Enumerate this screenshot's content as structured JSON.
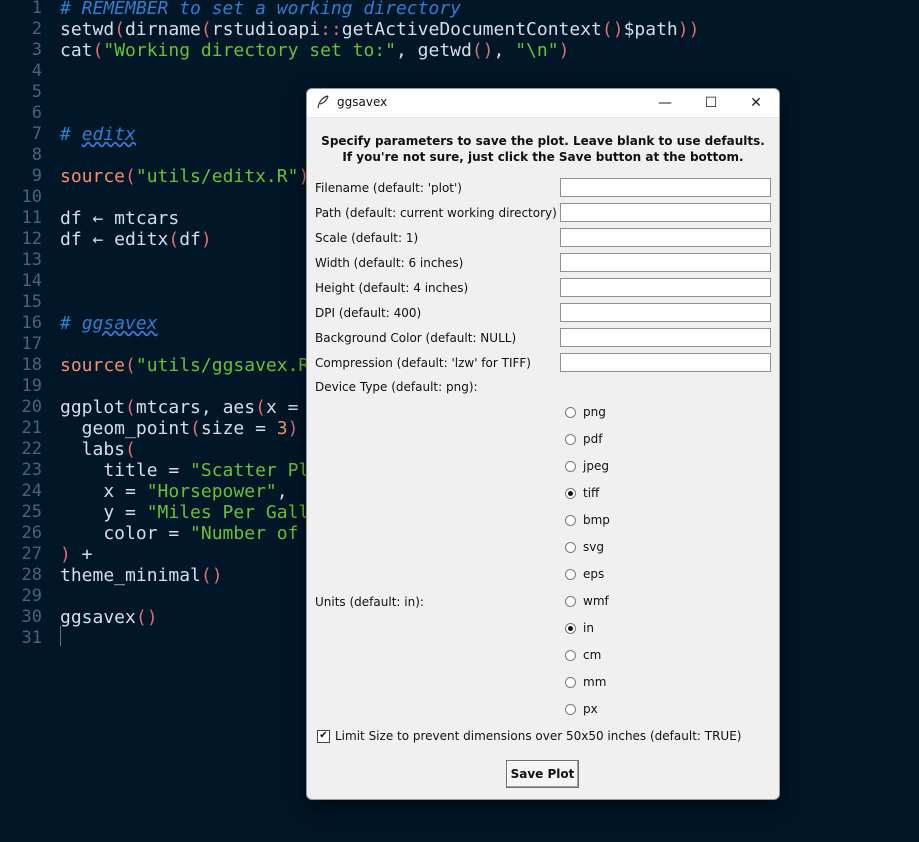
{
  "editor": {
    "lines": [
      {
        "n": "1",
        "segs": [
          {
            "t": "# REMEMBER to set a working directory",
            "c": "cm"
          }
        ]
      },
      {
        "n": "2",
        "segs": [
          {
            "t": "setwd",
            "c": "fn"
          },
          {
            "t": "(",
            "c": "pu"
          },
          {
            "t": "dirname",
            "c": "fn"
          },
          {
            "t": "(",
            "c": "pu"
          },
          {
            "t": "rstudioapi",
            "c": "fn"
          },
          {
            "t": "::",
            "c": "pu"
          },
          {
            "t": "getActiveDocumentContext",
            "c": "fn"
          },
          {
            "t": "()",
            "c": "pu"
          },
          {
            "t": "$path",
            "c": "fn"
          },
          {
            "t": "))",
            "c": "pu"
          }
        ]
      },
      {
        "n": "3",
        "segs": [
          {
            "t": "cat",
            "c": "fn"
          },
          {
            "t": "(",
            "c": "pu"
          },
          {
            "t": "\"Working directory set to:\"",
            "c": "str"
          },
          {
            "t": ", ",
            "c": "fn"
          },
          {
            "t": "getwd",
            "c": "fn"
          },
          {
            "t": "()",
            "c": "pu"
          },
          {
            "t": ", ",
            "c": "fn"
          },
          {
            "t": "\"\\n\"",
            "c": "str"
          },
          {
            "t": ")",
            "c": "pu"
          }
        ]
      },
      {
        "n": "4",
        "segs": []
      },
      {
        "n": "5",
        "segs": []
      },
      {
        "n": "6",
        "segs": []
      },
      {
        "n": "7",
        "segs": [
          {
            "t": "# ",
            "c": "cm"
          },
          {
            "t": "editx",
            "c": "cm-u"
          }
        ]
      },
      {
        "n": "8",
        "segs": []
      },
      {
        "n": "9",
        "segs": [
          {
            "t": "source",
            "c": "src"
          },
          {
            "t": "(",
            "c": "pu"
          },
          {
            "t": "\"utils/editx.R\"",
            "c": "str"
          },
          {
            "t": ")",
            "c": "pu"
          }
        ]
      },
      {
        "n": "10",
        "segs": []
      },
      {
        "n": "11",
        "segs": [
          {
            "t": "df ← mtcars",
            "c": "fn"
          }
        ]
      },
      {
        "n": "12",
        "segs": [
          {
            "t": "df ← editx",
            "c": "fn"
          },
          {
            "t": "(",
            "c": "pu"
          },
          {
            "t": "df",
            "c": "fn"
          },
          {
            "t": ")",
            "c": "pu"
          }
        ]
      },
      {
        "n": "13",
        "segs": []
      },
      {
        "n": "14",
        "segs": []
      },
      {
        "n": "15",
        "segs": []
      },
      {
        "n": "16",
        "segs": [
          {
            "t": "# ",
            "c": "cm"
          },
          {
            "t": "ggsavex",
            "c": "cm-u"
          }
        ]
      },
      {
        "n": "17",
        "segs": []
      },
      {
        "n": "18",
        "segs": [
          {
            "t": "source",
            "c": "src"
          },
          {
            "t": "(",
            "c": "pu"
          },
          {
            "t": "\"utils/ggsavex.R",
            "c": "str"
          }
        ]
      },
      {
        "n": "19",
        "segs": []
      },
      {
        "n": "20",
        "segs": [
          {
            "t": "ggplot",
            "c": "fn"
          },
          {
            "t": "(",
            "c": "pu"
          },
          {
            "t": "mtcars, ",
            "c": "fn"
          },
          {
            "t": "aes",
            "c": "fn"
          },
          {
            "t": "(",
            "c": "pu"
          },
          {
            "t": "x = ",
            "c": "fn"
          }
        ]
      },
      {
        "n": "21",
        "segs": [
          {
            "t": "  geom_point",
            "c": "fn"
          },
          {
            "t": "(",
            "c": "pu"
          },
          {
            "t": "size = ",
            "c": "fn"
          },
          {
            "t": "3",
            "c": "num"
          },
          {
            "t": ")",
            "c": "pu"
          }
        ]
      },
      {
        "n": "22",
        "segs": [
          {
            "t": "  labs",
            "c": "fn"
          },
          {
            "t": "(",
            "c": "pu"
          }
        ]
      },
      {
        "n": "23",
        "segs": [
          {
            "t": "    title = ",
            "c": "fn"
          },
          {
            "t": "\"Scatter Pl",
            "c": "str"
          }
        ]
      },
      {
        "n": "24",
        "segs": [
          {
            "t": "    x = ",
            "c": "fn"
          },
          {
            "t": "\"Horsepower\"",
            "c": "str"
          },
          {
            "t": ",",
            "c": "fn"
          }
        ]
      },
      {
        "n": "25",
        "segs": [
          {
            "t": "    y = ",
            "c": "fn"
          },
          {
            "t": "\"Miles Per Gall",
            "c": "str"
          }
        ]
      },
      {
        "n": "26",
        "segs": [
          {
            "t": "    color = ",
            "c": "fn"
          },
          {
            "t": "\"Number of",
            "c": "str"
          }
        ]
      },
      {
        "n": "27",
        "segs": [
          {
            "t": ")",
            "c": "pu"
          },
          {
            "t": " +",
            "c": "fn"
          }
        ]
      },
      {
        "n": "28",
        "segs": [
          {
            "t": "theme_minimal",
            "c": "fn"
          },
          {
            "t": "()",
            "c": "pu"
          }
        ]
      },
      {
        "n": "29",
        "segs": []
      },
      {
        "n": "30",
        "segs": [
          {
            "t": "ggsavex",
            "c": "fn"
          },
          {
            "t": "()",
            "c": "pu"
          }
        ]
      },
      {
        "n": "31",
        "segs": []
      }
    ]
  },
  "dialog": {
    "title": "ggsavex",
    "min_glyph": "—",
    "max_glyph": "☐",
    "close_glyph": "✕",
    "intro_line1": "Specify parameters to save the plot. Leave blank to use defaults.",
    "intro_line2": "If you're not sure, just click the Save button at the bottom.",
    "fields": [
      {
        "label": "Filename (default: 'plot')",
        "value": ""
      },
      {
        "label": "Path (default: current working directory)",
        "value": ""
      },
      {
        "label": "Scale (default: 1)",
        "value": ""
      },
      {
        "label": "Width (default: 6 inches)",
        "value": ""
      },
      {
        "label": "Height (default: 4 inches)",
        "value": ""
      },
      {
        "label": "DPI (default: 400)",
        "value": ""
      },
      {
        "label": "Background Color (default: NULL)",
        "value": ""
      },
      {
        "label": "Compression (default: 'lzw' for TIFF)",
        "value": ""
      }
    ],
    "device_label": "Device Type (default: png):",
    "device_options": [
      "png",
      "pdf",
      "jpeg",
      "tiff",
      "bmp",
      "svg",
      "eps",
      "wmf"
    ],
    "device_selected": "tiff",
    "units_label": "Units (default: in):",
    "unit_options": [
      "in",
      "cm",
      "mm",
      "px"
    ],
    "unit_selected": "in",
    "limit_label": "Limit Size to prevent dimensions over 50x50 inches (default: TRUE)",
    "limit_checked": true,
    "check_glyph": "✔",
    "save_label": "Save Plot"
  }
}
